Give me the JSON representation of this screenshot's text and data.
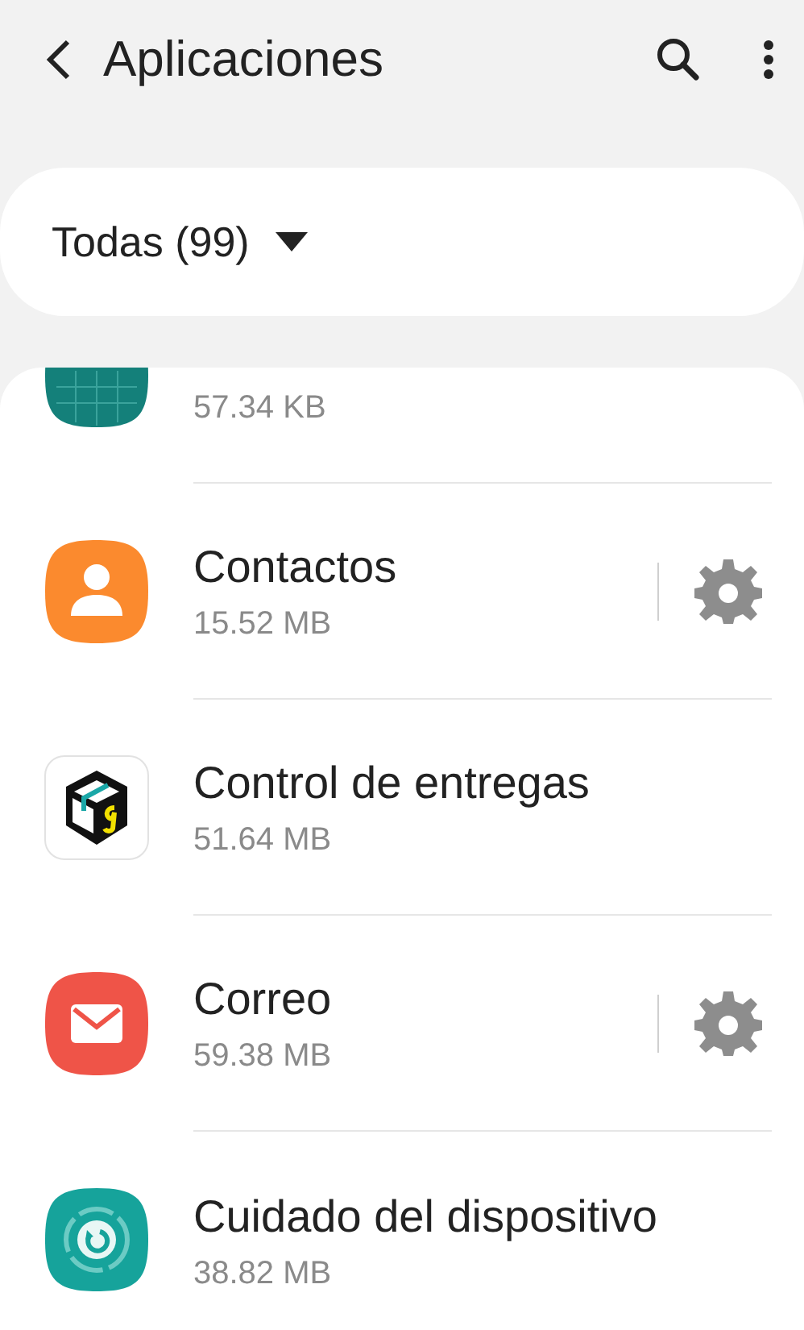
{
  "header": {
    "title": "Aplicaciones"
  },
  "filter": {
    "label": "Todas (99)"
  },
  "apps": [
    {
      "size": "57.34 KB",
      "kind": "android",
      "settings": false
    },
    {
      "name": "Contactos",
      "size": "15.52 MB",
      "kind": "contacts",
      "settings": true
    },
    {
      "name": "Control de entregas",
      "size": "51.64 MB",
      "kind": "box",
      "settings": false
    },
    {
      "name": "Correo",
      "size": "59.38 MB",
      "kind": "mail",
      "settings": true
    },
    {
      "name": "Cuidado del dispositivo",
      "size": "38.82 MB",
      "kind": "care",
      "settings": false
    }
  ]
}
